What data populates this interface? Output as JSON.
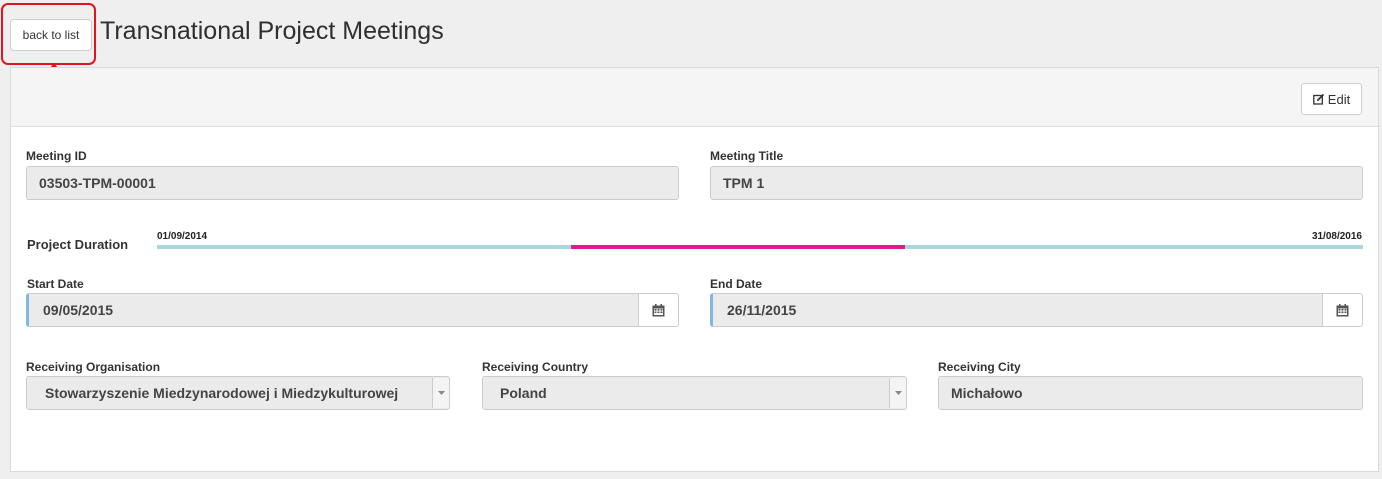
{
  "header": {
    "back_label": "back to list",
    "title": "Transnational Project Meetings"
  },
  "panel": {
    "edit_label": "Edit",
    "edit_icon": "edit-icon"
  },
  "fields": {
    "meeting_id": {
      "label": "Meeting ID",
      "value": "03503-TPM-00001"
    },
    "meeting_title": {
      "label": "Meeting Title",
      "value": "TPM 1"
    },
    "start_date": {
      "label": "Start Date",
      "value": "09/05/2015"
    },
    "end_date": {
      "label": "End Date",
      "value": "26/11/2015"
    },
    "receiving_organisation": {
      "label": "Receiving Organisation",
      "value": "Stowarzyszenie Miedzynarodowej i Miedzykulturowej"
    },
    "receiving_country": {
      "label": "Receiving Country",
      "value": "Poland"
    },
    "receiving_city": {
      "label": "Receiving City",
      "value": "Michałowo"
    }
  },
  "duration": {
    "label": "Project Duration",
    "start": "01/09/2014",
    "end": "31/08/2016",
    "meeting_start_fraction": 0.343,
    "meeting_end_fraction": 0.62
  },
  "colors": {
    "highlight": "#e3141c",
    "timeline_track": "#a8d6de",
    "timeline_fill": "#de1a8e",
    "date_accent": "#7fb8e0"
  }
}
